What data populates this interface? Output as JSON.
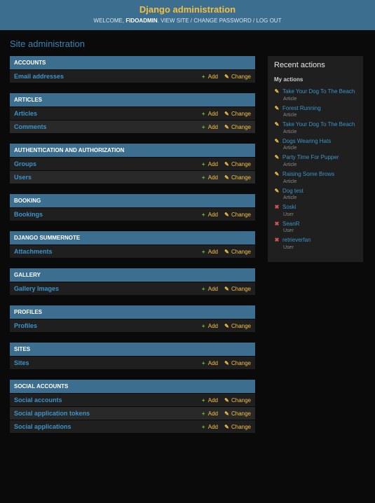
{
  "header": {
    "branding": "Django administration",
    "welcome": "WELCOME,",
    "username": "FIDOADMIN",
    "view_site": "VIEW SITE",
    "change_password": "CHANGE PASSWORD",
    "logout": "LOG OUT"
  },
  "page_title": "Site administration",
  "add_label": "Add",
  "change_label": "Change",
  "apps": [
    {
      "name": "ACCOUNTS",
      "models": [
        {
          "name": "Email addresses"
        }
      ]
    },
    {
      "name": "ARTICLES",
      "models": [
        {
          "name": "Articles"
        },
        {
          "name": "Comments"
        }
      ]
    },
    {
      "name": "AUTHENTICATION AND AUTHORIZATION",
      "models": [
        {
          "name": "Groups"
        },
        {
          "name": "Users"
        }
      ]
    },
    {
      "name": "BOOKING",
      "models": [
        {
          "name": "Bookings"
        }
      ]
    },
    {
      "name": "DJANGO SUMMERNOTE",
      "models": [
        {
          "name": "Attachments"
        }
      ]
    },
    {
      "name": "GALLERY",
      "models": [
        {
          "name": "Gallery Images"
        }
      ]
    },
    {
      "name": "PROFILES",
      "models": [
        {
          "name": "Profiles"
        }
      ]
    },
    {
      "name": "SITES",
      "models": [
        {
          "name": "Sites"
        }
      ]
    },
    {
      "name": "SOCIAL ACCOUNTS",
      "models": [
        {
          "name": "Social accounts"
        },
        {
          "name": "Social application tokens"
        },
        {
          "name": "Social applications"
        }
      ]
    }
  ],
  "recent": {
    "title": "Recent actions",
    "subtitle": "My actions",
    "items": [
      {
        "icon": "change",
        "label": "Take Your Dog To The Beach",
        "type": "Article"
      },
      {
        "icon": "change",
        "label": "Forest Running",
        "type": "Article"
      },
      {
        "icon": "change",
        "label": "Take Your Dog To The Beach",
        "type": "Article"
      },
      {
        "icon": "change",
        "label": "Dogs Wearing Hats",
        "type": "Article"
      },
      {
        "icon": "change",
        "label": "Party Time For Pupper",
        "type": "Article"
      },
      {
        "icon": "change",
        "label": "Raising Some Brows",
        "type": "Article"
      },
      {
        "icon": "change",
        "label": "Dog test",
        "type": "Article"
      },
      {
        "icon": "delete",
        "label": "Soski",
        "type": "User"
      },
      {
        "icon": "delete",
        "label": "SeanR",
        "type": "User"
      },
      {
        "icon": "delete",
        "label": "retrieverfan",
        "type": "User"
      }
    ]
  }
}
